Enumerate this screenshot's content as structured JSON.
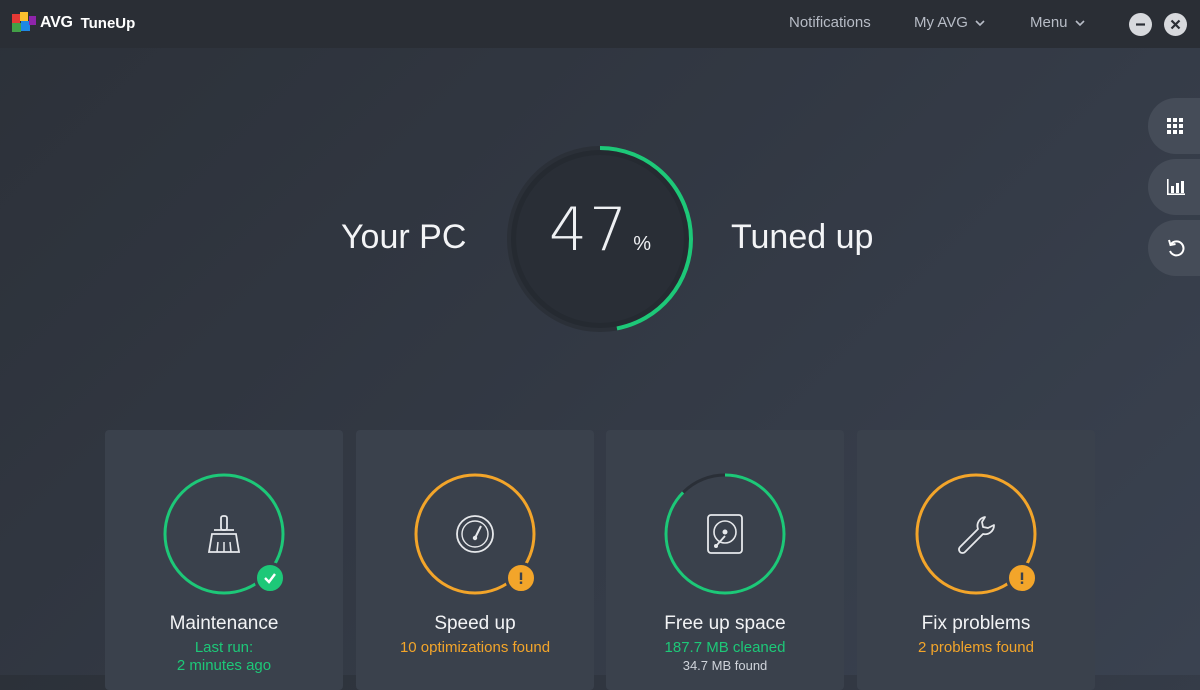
{
  "app": {
    "brand": "AVG",
    "product": "TuneUp"
  },
  "nav": {
    "notifications": "Notifications",
    "my_avg": "My AVG",
    "menu": "Menu"
  },
  "window": {
    "minimize_icon": "minimize-icon",
    "close_icon": "close-icon"
  },
  "side_panel": [
    "grid-icon",
    "chart-icon",
    "undo-icon"
  ],
  "hero": {
    "left_text": "Your PC",
    "right_text": "Tuned up",
    "percent": "47",
    "percent_unit": "%",
    "progress": 0.47
  },
  "colors": {
    "green": "#1dc878",
    "orange": "#f3a52a",
    "card_bg": "#3a414c"
  },
  "cards": [
    {
      "title": "Maintenance",
      "status_line1": "Last run:",
      "status_line2": "2 minutes ago",
      "status_color": "green",
      "badge": "check",
      "icon": "broom-icon"
    },
    {
      "title": "Speed up",
      "status_line1": "10 optimizations found",
      "status_color": "orange",
      "badge": "warning",
      "icon": "speedometer-icon"
    },
    {
      "title": "Free up space",
      "status_line1": "187.7 MB cleaned",
      "status_line2": "34.7 MB found",
      "status_color": "green",
      "badge": "none",
      "icon": "hard-drive-icon"
    },
    {
      "title": "Fix problems",
      "status_line1": "2 problems found",
      "status_color": "orange",
      "badge": "warning",
      "icon": "wrench-icon"
    }
  ]
}
